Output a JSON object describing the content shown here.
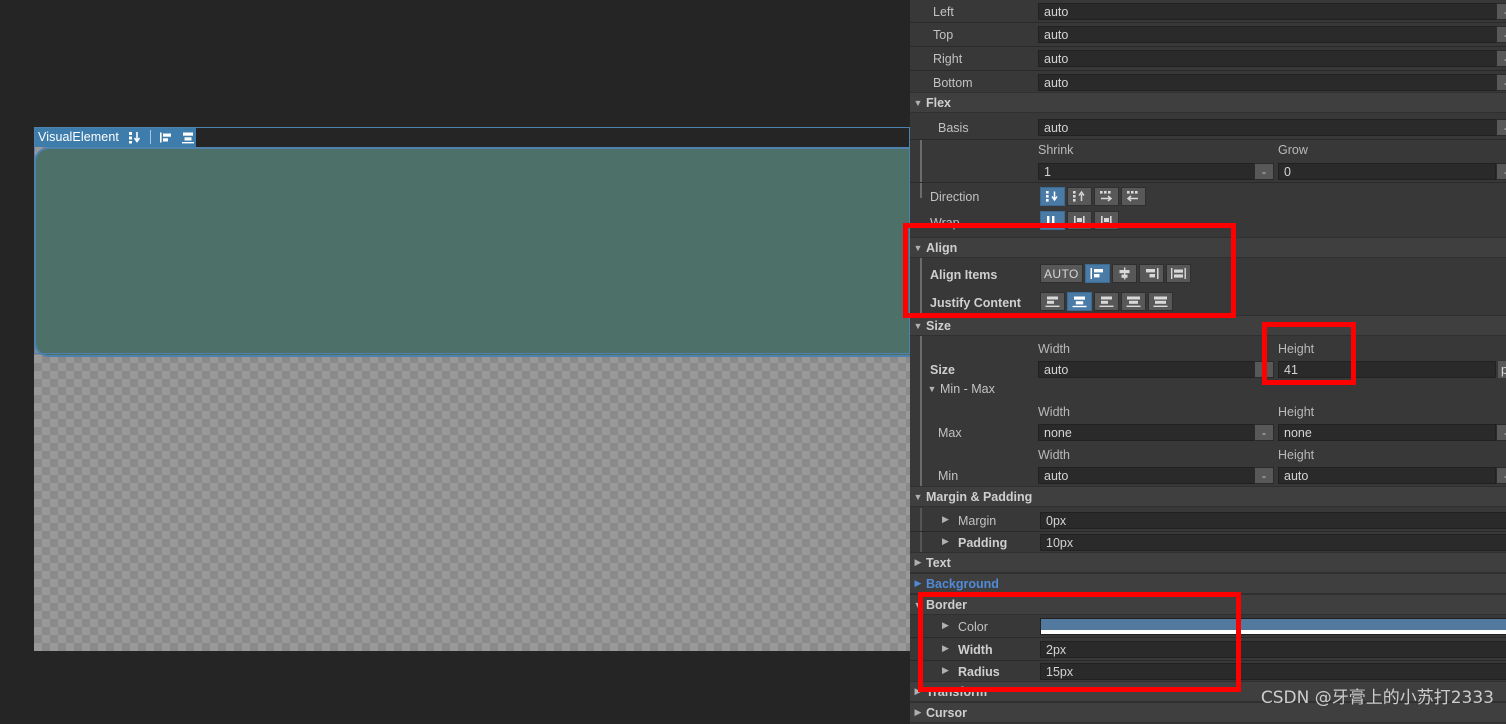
{
  "canvas": {
    "element_badge": {
      "label": "VisualElement",
      "icons": [
        "flex-direction-column-icon",
        "align-items-flex-start-icon",
        "justify-content-center-icon"
      ]
    },
    "element_style": {
      "background_color": "#4d7068",
      "border_color": "#4e81ae",
      "border_width": "2px",
      "border_radius": "15px"
    }
  },
  "inspector": {
    "position": {
      "fields": [
        {
          "label": "Left",
          "value": "auto",
          "stepper": "-"
        },
        {
          "label": "Top",
          "value": "auto",
          "stepper": "-"
        },
        {
          "label": "Right",
          "value": "auto",
          "stepper": "-"
        },
        {
          "label": "Bottom",
          "value": "auto",
          "stepper": "-"
        }
      ]
    },
    "flex": {
      "title": "Flex",
      "basis": {
        "label": "Basis",
        "value": "auto",
        "stepper": "-"
      },
      "shrink": {
        "label": "Shrink",
        "value": "1",
        "stepper": "-"
      },
      "grow": {
        "label": "Grow",
        "value": "0",
        "stepper": "-"
      },
      "direction": {
        "label": "Direction",
        "options": [
          "column",
          "column-reverse",
          "row",
          "row-reverse"
        ],
        "selected_index": 0
      },
      "wrap": {
        "label": "Wrap",
        "options": [
          "nowrap",
          "wrap",
          "wrap-reverse"
        ],
        "selected_index": 0
      }
    },
    "align": {
      "title": "Align",
      "align_items": {
        "label": "Align Items",
        "options": [
          "AUTO",
          "flex-start",
          "center",
          "flex-end",
          "stretch"
        ],
        "selected_index": 1
      },
      "justify_content": {
        "label": "Justify Content",
        "options": [
          "flex-start",
          "center",
          "flex-end",
          "space-between",
          "space-around"
        ],
        "selected_index": 1
      }
    },
    "size": {
      "title": "Size",
      "row_label": "Size",
      "width_header": "Width",
      "height_header": "Height",
      "width_value": "auto",
      "height_value": "41",
      "height_unit": "p",
      "minmax_title": "Min - Max",
      "max": {
        "label": "Max",
        "width_header": "Width",
        "height_header": "Height",
        "width_value": "none",
        "height_value": "none",
        "stepper": "-"
      },
      "min": {
        "label": "Min",
        "width_header": "Width",
        "height_header": "Height",
        "width_value": "auto",
        "height_value": "auto",
        "stepper": "-"
      }
    },
    "margin_padding": {
      "title": "Margin & Padding",
      "margin": {
        "label": "Margin",
        "value": "0px"
      },
      "padding": {
        "label": "Padding",
        "value": "10px"
      }
    },
    "text": {
      "title": "Text"
    },
    "background": {
      "title": "Background"
    },
    "border": {
      "title": "Border",
      "color": {
        "label": "Color",
        "value": "#54799e"
      },
      "width": {
        "label": "Width",
        "value": "2px"
      },
      "radius": {
        "label": "Radius",
        "value": "15px"
      }
    },
    "transform": {
      "title": "Transform"
    },
    "cursor": {
      "title": "Cursor"
    }
  },
  "watermark": {
    "text": "CSDN @牙膏上的小苏打2333"
  }
}
